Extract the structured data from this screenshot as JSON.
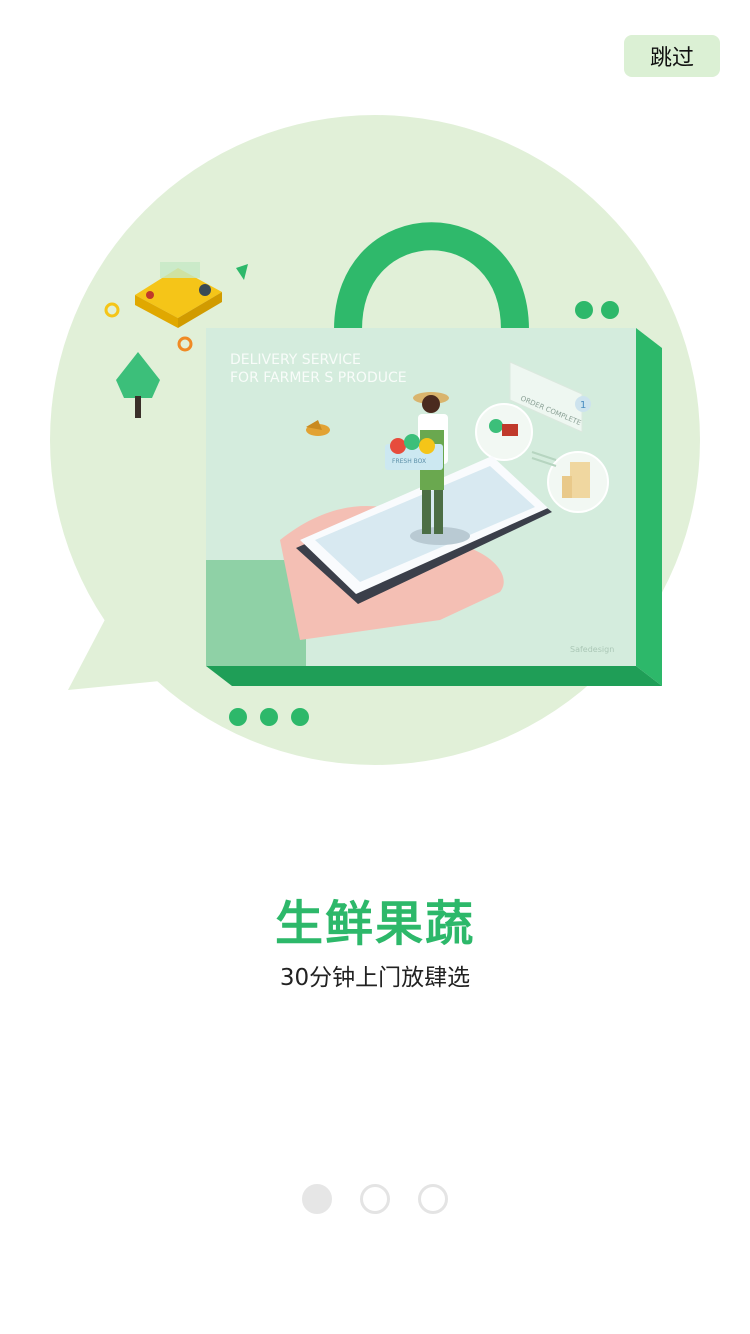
{
  "header": {
    "skip_label": "跳过"
  },
  "illustration": {
    "line1": "DELIVERY SERVICE",
    "line2": "FOR FARMER S PRODUCE",
    "box_label": "FRESH BOX",
    "order_label": "ORDER COMPLETE",
    "order_count": "1",
    "watermark": "Safedesign"
  },
  "content": {
    "title": "生鲜果蔬",
    "subtitle": "30分钟上门放肆选"
  },
  "pager": {
    "total": 3,
    "active_index": 0
  },
  "colors": {
    "brand_green": "#2db86a",
    "bubble_bg": "#e1f0d8",
    "skip_bg": "#dbf0d4"
  }
}
